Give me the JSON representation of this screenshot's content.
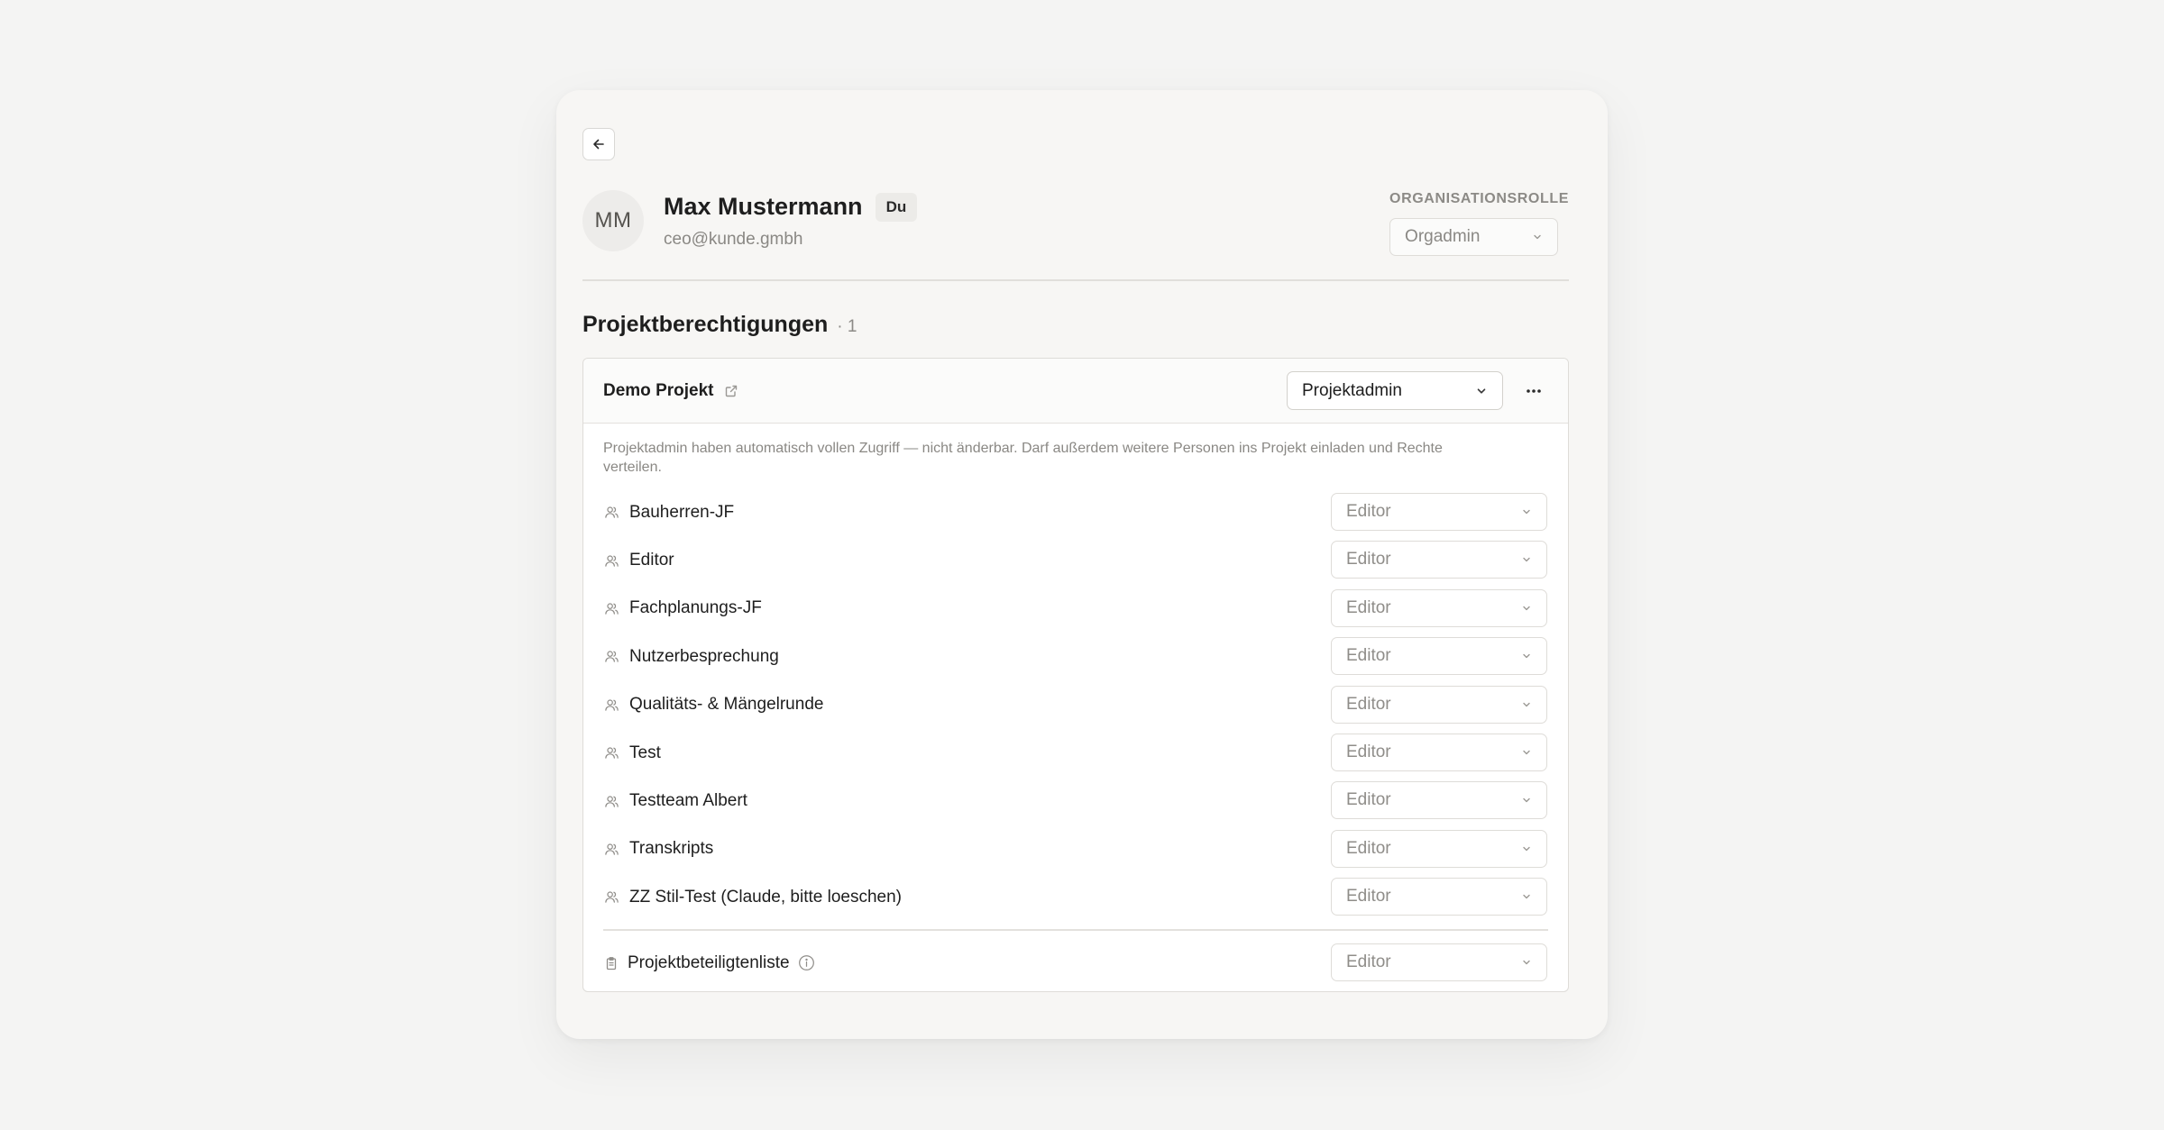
{
  "user": {
    "initials": "MM",
    "name": "Max Mustermann",
    "badge": "Du",
    "email": "ceo@kunde.gmbh"
  },
  "org_role": {
    "label": "ORGANISATIONSROLLE",
    "value": "Orgadmin"
  },
  "permissions": {
    "title": "Projektberechtigungen",
    "count": "· 1"
  },
  "project": {
    "name": "Demo Projekt",
    "role": "Projektadmin",
    "hint": "Projektadmin haben automatisch vollen Zugriff — nicht änderbar. Darf außerdem weitere Personen ins Projekt einladen und Rechte verteilen.",
    "groups": [
      {
        "label": "Bauherren-JF",
        "role": "Editor"
      },
      {
        "label": "Editor",
        "role": "Editor"
      },
      {
        "label": "Fachplanungs-JF",
        "role": "Editor"
      },
      {
        "label": "Nutzerbesprechung",
        "role": "Editor"
      },
      {
        "label": "Qualitäts- & Mängelrunde",
        "role": "Editor"
      },
      {
        "label": "Test",
        "role": "Editor"
      },
      {
        "label": "Testteam Albert",
        "role": "Editor"
      },
      {
        "label": "Transkripts",
        "role": "Editor"
      },
      {
        "label": "ZZ Stil-Test (Claude, bitte loeschen)",
        "role": "Editor"
      }
    ],
    "participants": {
      "label": "Projektbeteiligtenliste",
      "role": "Editor"
    }
  },
  "icons": {
    "back": "arrow-left-icon",
    "external": "external-link-icon",
    "more": "more-horizontal-icon",
    "group": "users-icon",
    "clipboard": "clipboard-icon",
    "info": "info-icon",
    "chevron": "chevron-down-icon"
  }
}
